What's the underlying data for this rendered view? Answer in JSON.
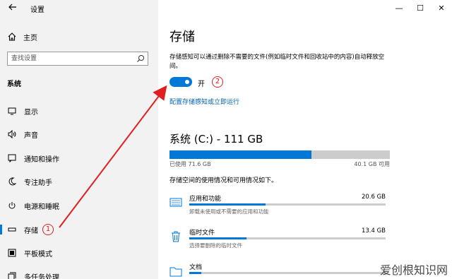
{
  "window": {
    "title": "设置",
    "controls": [
      "—",
      "☐",
      "✕"
    ]
  },
  "sidebar": {
    "home_label": "主页",
    "search_placeholder": "查找设置",
    "section_label": "系统",
    "items": [
      {
        "label": "显示",
        "icon": "display-icon"
      },
      {
        "label": "声音",
        "icon": "sound-icon"
      },
      {
        "label": "通知和操作",
        "icon": "notification-icon"
      },
      {
        "label": "专注助手",
        "icon": "moon-icon"
      },
      {
        "label": "电源和睡眠",
        "icon": "power-icon"
      },
      {
        "label": "存储",
        "icon": "storage-icon",
        "active": true
      },
      {
        "label": "平板模式",
        "icon": "tablet-icon"
      },
      {
        "label": "多任务处理",
        "icon": "multitask-icon"
      }
    ]
  },
  "main": {
    "title": "存储",
    "description": "存储感知可以通过删除不需要的文件(例如临时文件和回收站中的内容)自动释放空间。",
    "toggle": {
      "state": true,
      "label": "开"
    },
    "link": "配置存储感知或立即运行",
    "drive": {
      "title": "系统 (C:) - 111 GB",
      "used_label": "已使用 71.6 GB",
      "free_label": "40.1 GB 可用",
      "used_fraction": 0.645
    },
    "usage_subtitle": "存储空间的使用情况和可用情况如下。",
    "categories": [
      {
        "name": "应用和功能",
        "size": "20.6 GB",
        "desc": "卸载未使用或不需要的应用和功能",
        "fraction": 0.39,
        "icon": "apps-icon"
      },
      {
        "name": "临时文件",
        "size": "13.4 GB",
        "desc": "选择要删除的临时文件",
        "fraction": 0.29,
        "icon": "trash-icon"
      },
      {
        "name": "文档",
        "size": "",
        "desc": "",
        "fraction": 0.06,
        "icon": "folder-icon"
      }
    ]
  },
  "annotations": {
    "badge1": "1",
    "badge2": "2",
    "arrow_color": "#e02020"
  },
  "watermark": "爱创根知识网",
  "colors": {
    "accent": "#0078d7",
    "sidebar_bg": "#f2f2f2",
    "link": "#0063b1"
  }
}
